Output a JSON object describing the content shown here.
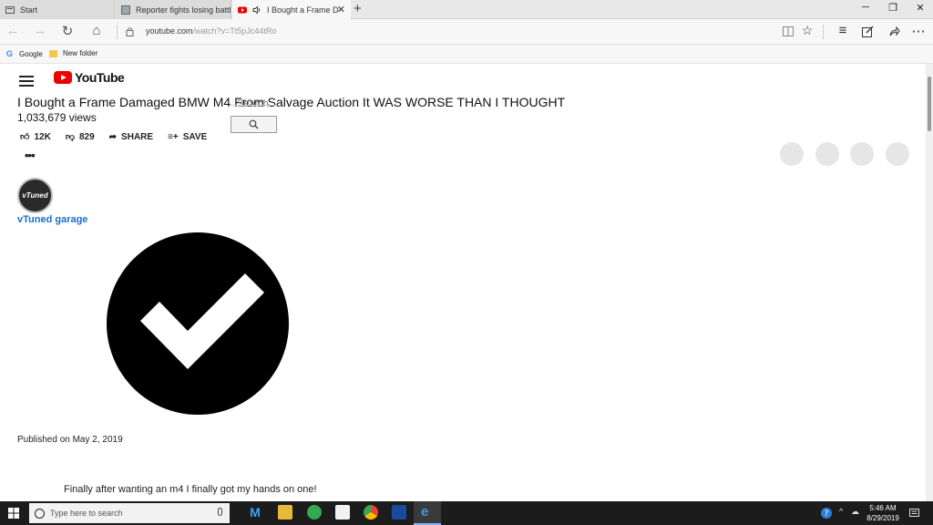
{
  "browser": {
    "tabs": [
      {
        "label": "Start",
        "icon": "start-page-icon"
      },
      {
        "label": "Reporter fights losing battle",
        "icon": "page-icon"
      },
      {
        "label": "I Bought a Frame D",
        "icon": "youtube-icon",
        "audio_icon": "speaker-icon",
        "active": true
      }
    ],
    "address": {
      "domain": "youtube.com",
      "path": "/watch?v=Tt5pJc44tRo"
    },
    "favorites": [
      {
        "label": "Google",
        "icon": "google-icon"
      },
      {
        "label": "New folder",
        "icon": "folder-icon"
      }
    ]
  },
  "page": {
    "logo_text": "YouTube",
    "video_title": "I Bought a Frame Damaged BMW M4 From Salvage Auction It WAS WORSE THAN I THOUGHT",
    "views": "1,033,679 views",
    "search_placeholder": "Search",
    "actions": {
      "like": "12K",
      "dislike": "829",
      "share": "SHARE",
      "save": "SAVE"
    },
    "more_label": "•••",
    "channel": {
      "name": "vTuned garage",
      "avatar_text": "vTuned"
    },
    "published": "Published on May 2, 2019",
    "description": "Finally after wanting an m4 I finally got my hands on one!"
  },
  "taskbar": {
    "search_placeholder": "Type here to search",
    "time": "5:46 AM",
    "date": "8/29/2019"
  },
  "colors": {
    "youtube_red": "#ee0000",
    "channel_link": "#1a6fc9",
    "taskbar": "#1c1c1c"
  }
}
